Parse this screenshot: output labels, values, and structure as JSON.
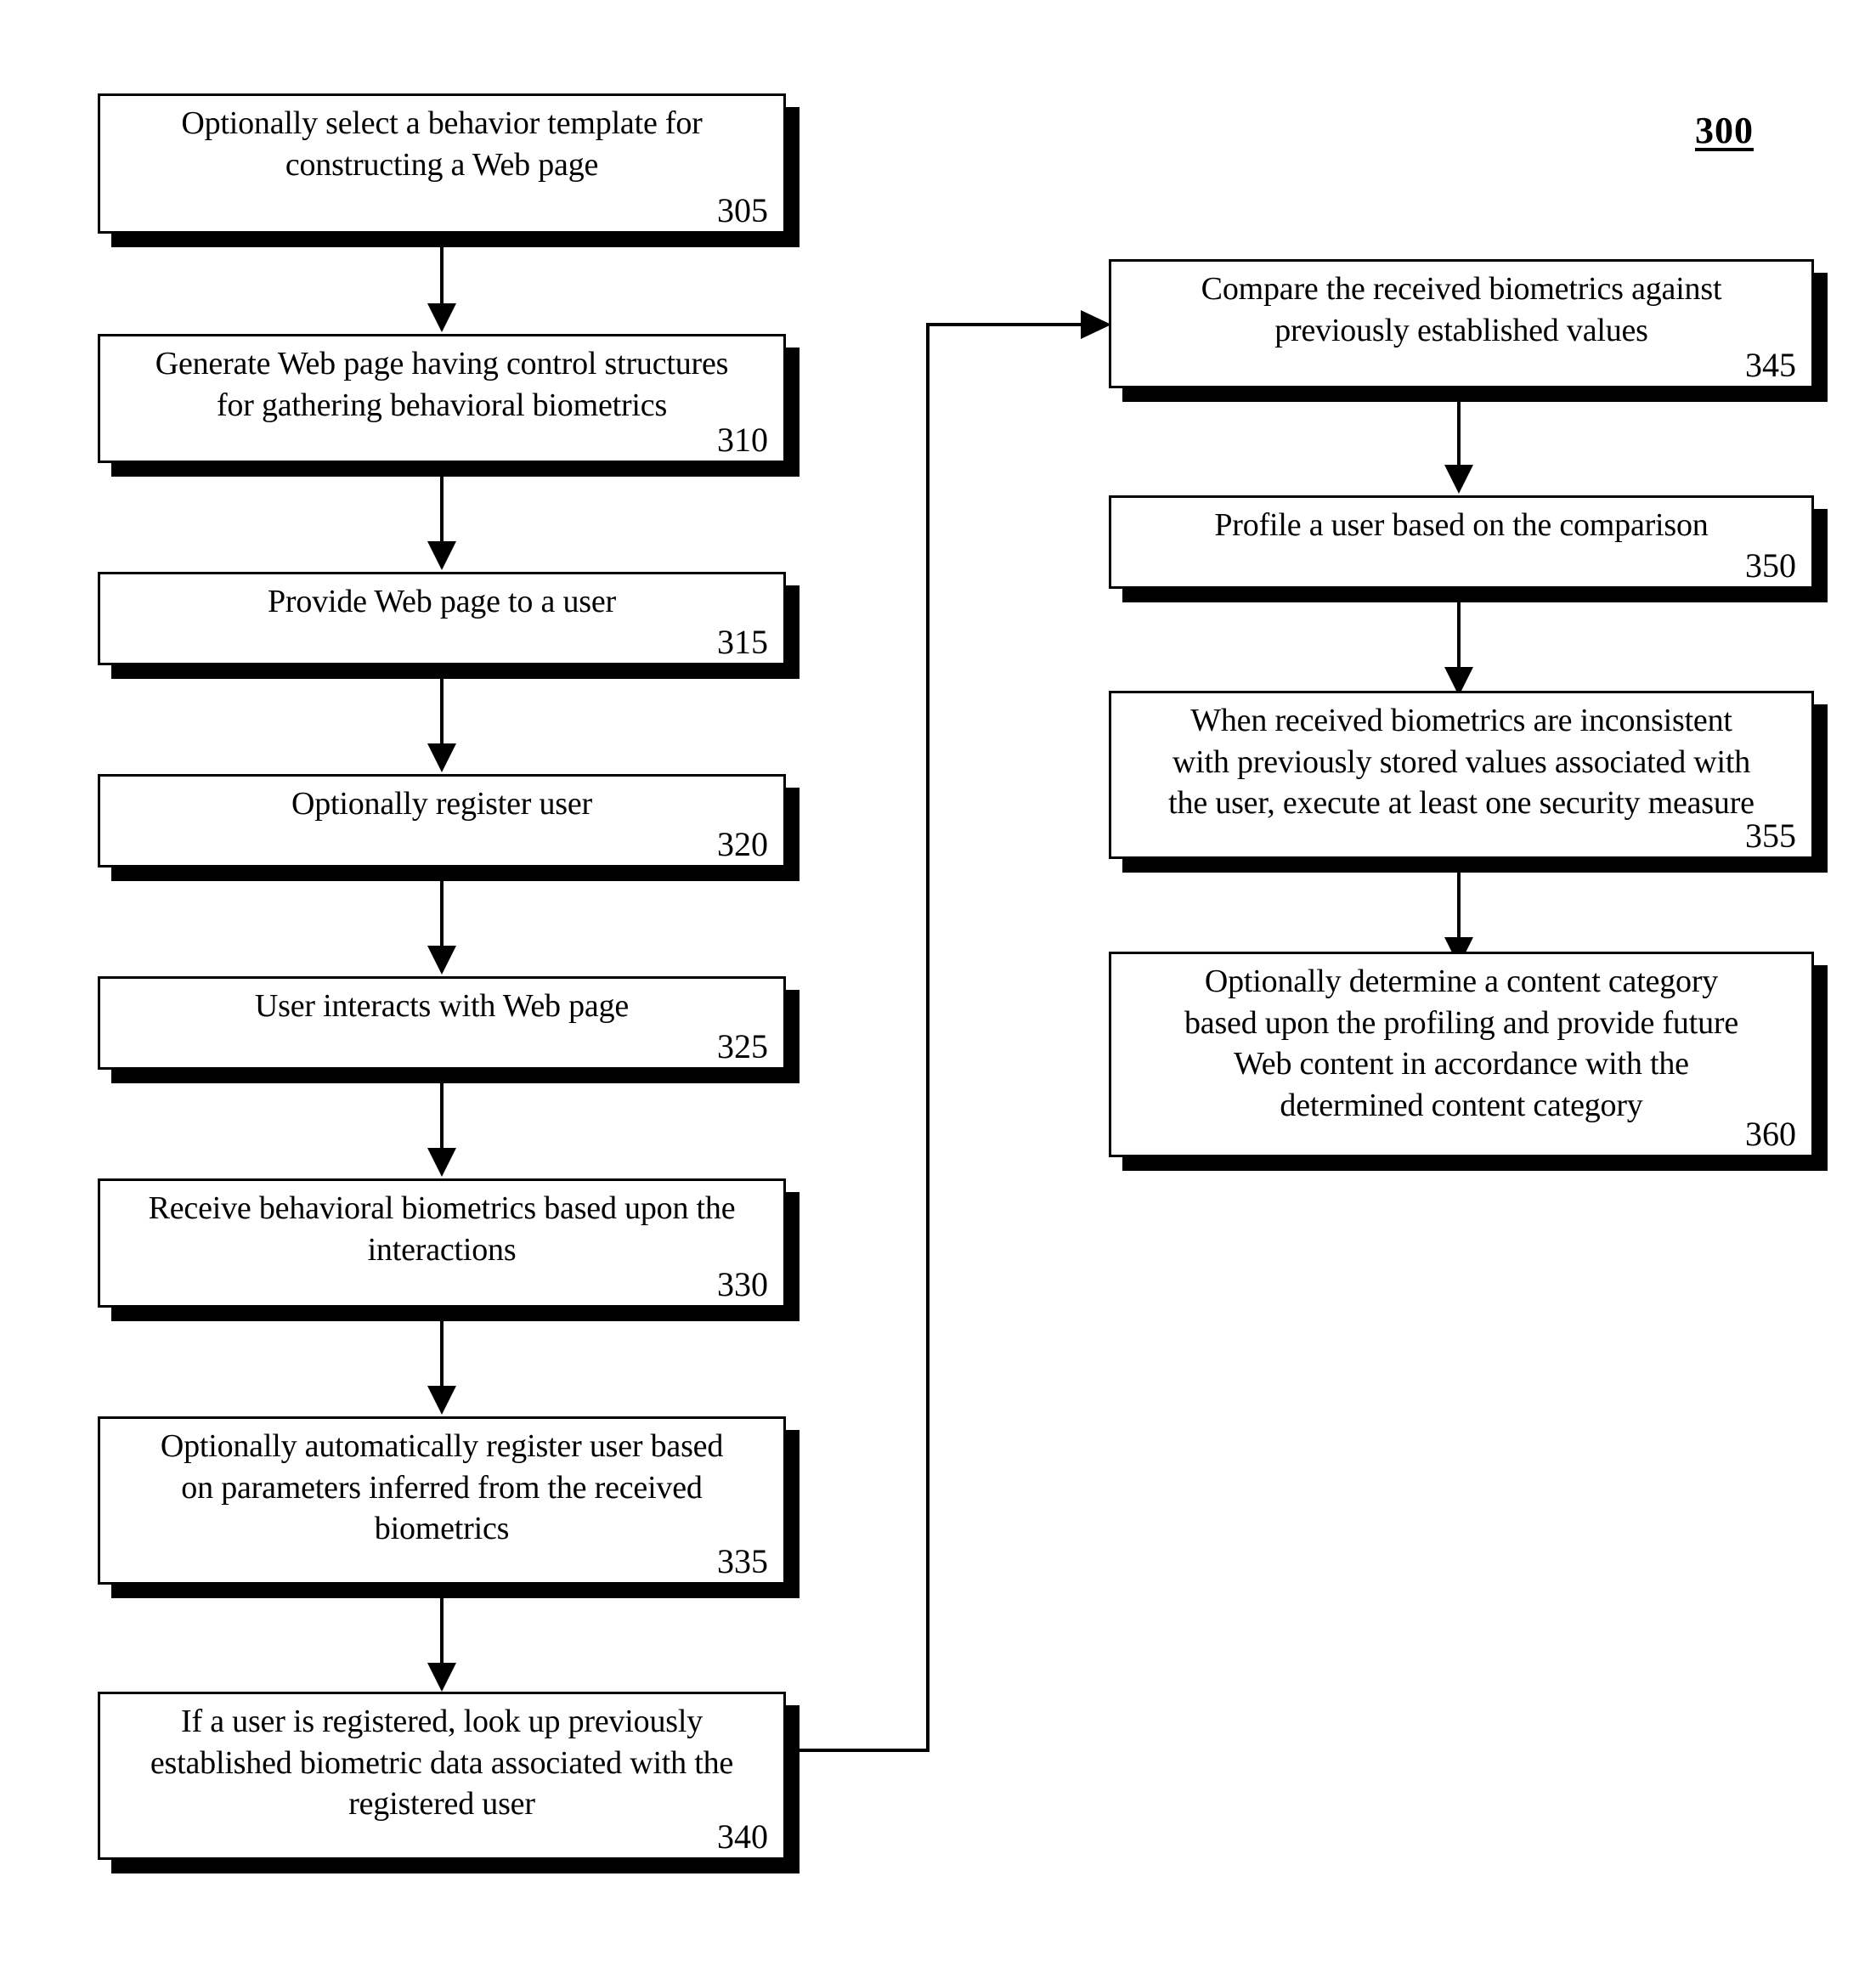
{
  "figure": {
    "number": "300"
  },
  "nodes": [
    {
      "id": "305",
      "text": "Optionally select a behavior template for\nconstructing a Web page",
      "number": "305"
    },
    {
      "id": "310",
      "text": "Generate Web page having control structures\nfor gathering behavioral biometrics",
      "number": "310"
    },
    {
      "id": "315",
      "text": "Provide Web page to a user",
      "number": "315"
    },
    {
      "id": "320",
      "text": "Optionally register user",
      "number": "320"
    },
    {
      "id": "325",
      "text": "User interacts with Web page",
      "number": "325"
    },
    {
      "id": "330",
      "text": "Receive behavioral biometrics based upon the\ninteractions",
      "number": "330"
    },
    {
      "id": "335",
      "text": "Optionally automatically register user based\non parameters inferred from the received\nbiometrics",
      "number": "335"
    },
    {
      "id": "340",
      "text": "If a user is registered, look up previously\nestablished biometric data associated with the\nregistered user",
      "number": "340"
    },
    {
      "id": "345",
      "text": "Compare the received biometrics against\npreviously established values",
      "number": "345"
    },
    {
      "id": "350",
      "text": "Profile a user based on the comparison",
      "number": "350"
    },
    {
      "id": "355",
      "text": "When received biometrics are inconsistent\nwith previously stored values associated with\nthe user, execute at least one security measure",
      "number": "355"
    },
    {
      "id": "360",
      "text": "Optionally determine a content category\nbased upon the profiling and provide future\nWeb content in accordance with the\ndetermined content category",
      "number": "360"
    }
  ],
  "colors": {
    "stroke": "#000000",
    "fill": "#ffffff",
    "shadow": "#000000"
  }
}
